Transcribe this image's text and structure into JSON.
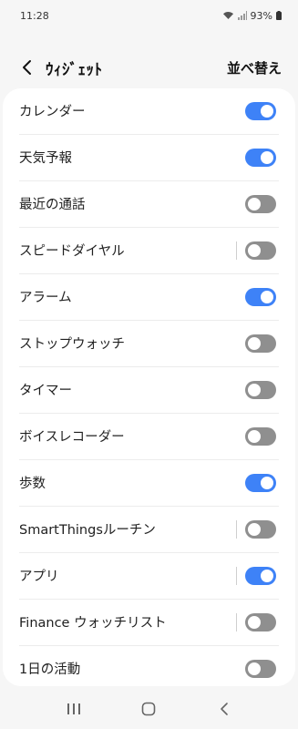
{
  "status_bar": {
    "time": "11:28",
    "battery": "93%",
    "icons": [
      "wifi-icon",
      "signal-icon",
      "battery-icon"
    ]
  },
  "header": {
    "title": "ｳｨｼﾞｪｯﾄ",
    "reorder_label": "並べ替え",
    "back_icon": "chevron-left-icon"
  },
  "widgets": [
    {
      "label": "カレンダー",
      "enabled": true,
      "divider": false
    },
    {
      "label": "天気予報",
      "enabled": true,
      "divider": false
    },
    {
      "label": "最近の通話",
      "enabled": false,
      "divider": false
    },
    {
      "label": "スピードダイヤル",
      "enabled": false,
      "divider": true
    },
    {
      "label": "アラーム",
      "enabled": true,
      "divider": false
    },
    {
      "label": "ストップウォッチ",
      "enabled": false,
      "divider": false
    },
    {
      "label": "タイマー",
      "enabled": false,
      "divider": false
    },
    {
      "label": "ボイスレコーダー",
      "enabled": false,
      "divider": false
    },
    {
      "label": "歩数",
      "enabled": true,
      "divider": false
    },
    {
      "label": "SmartThingsルーチン",
      "enabled": false,
      "divider": true
    },
    {
      "label": "アプリ",
      "enabled": true,
      "divider": true
    },
    {
      "label": "Finance ウォッチリスト",
      "enabled": false,
      "divider": true
    },
    {
      "label": "1日の活動",
      "enabled": false,
      "divider": false
    }
  ],
  "nav_bar": {
    "recents_icon": "recents-icon",
    "home_icon": "home-icon",
    "back_icon": "back-icon"
  },
  "colors": {
    "accent": "#3e82f7",
    "toggle_off": "#8f8f8f",
    "background": "#f6f6f6",
    "card": "#ffffff"
  }
}
